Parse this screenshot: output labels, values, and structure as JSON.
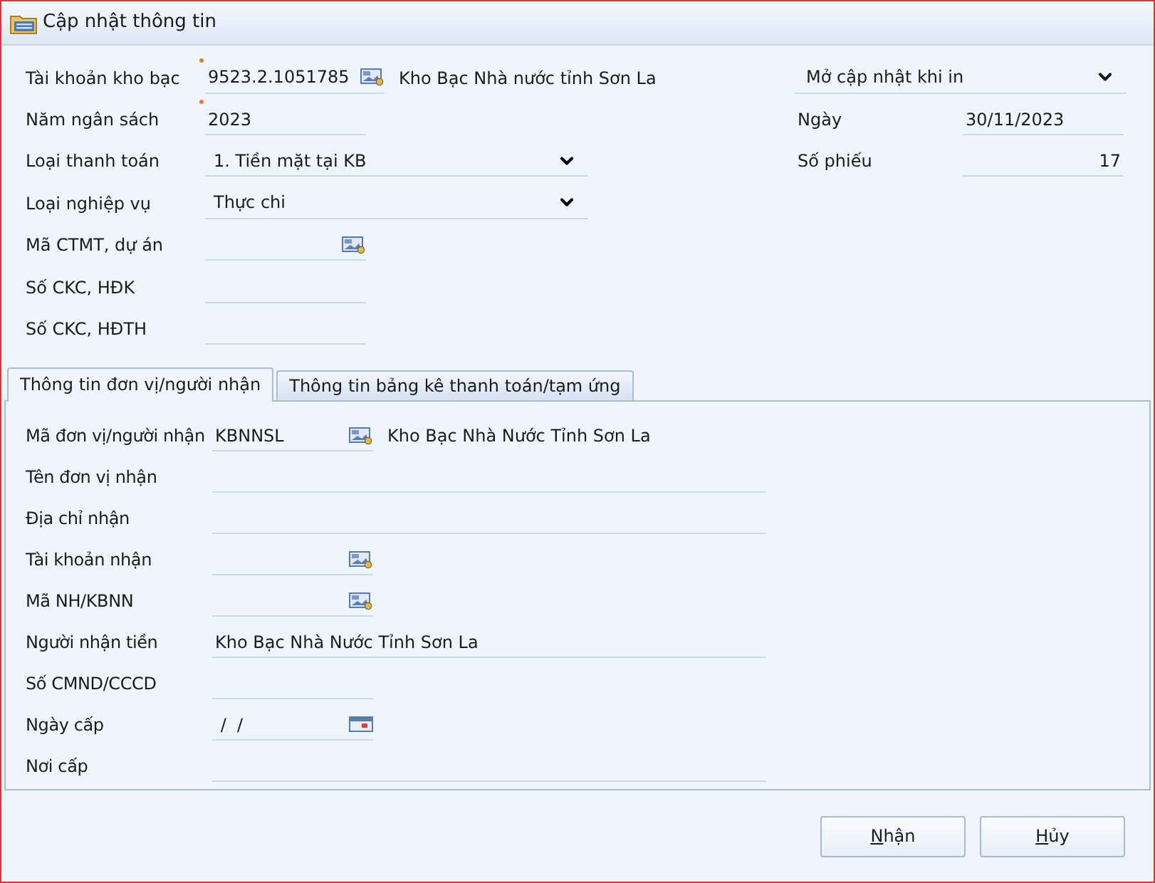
{
  "window": {
    "title": "Cập nhật thông tin"
  },
  "top_fields": [
    {
      "kind": "lookup",
      "label": "Tài khoản kho bạc",
      "required": true,
      "value": "9523.2.1051785",
      "description": "Kho Bạc Nhà nước tỉnh Sơn La"
    },
    {
      "kind": "text",
      "label": "Năm ngân sách",
      "required": true,
      "value": "2023"
    },
    {
      "kind": "select",
      "label": "Loại thanh toán",
      "value": "1. Tiền mặt tại KB"
    },
    {
      "kind": "select",
      "label": "Loại nghiệp vụ",
      "value": "Thực chi"
    },
    {
      "kind": "lookup",
      "label": "Mã CTMT, dự án"
    },
    {
      "kind": "text",
      "label": "Số CKC, HĐK"
    },
    {
      "kind": "text",
      "label": "Số CKC, HĐTH"
    }
  ],
  "print_mode": {
    "value": "Mở cập nhật khi in"
  },
  "right_fields": [
    {
      "kind": "date",
      "label": "Ngày",
      "value": "30/11/2023"
    },
    {
      "kind": "number",
      "label": "Số phiếu",
      "value": "17"
    }
  ],
  "tabs": [
    {
      "label": "Thông tin đơn vị/người nhận",
      "selected": true
    },
    {
      "label": "Thông tin bảng kê thanh toán/tạm ứng",
      "selected": false
    }
  ],
  "tab_fields": [
    {
      "kind": "lookup",
      "label": "Mã đơn vị/người nhận",
      "value": "KBNNSL",
      "description": "Kho Bạc Nhà Nước Tỉnh Sơn La"
    },
    {
      "kind": "longtext",
      "label": "Tên đơn vị nhận"
    },
    {
      "kind": "longtext",
      "label": "Địa chỉ nhận"
    },
    {
      "kind": "lookup",
      "label": "Tài khoản nhận"
    },
    {
      "kind": "lookup",
      "label": "Mã NH/KBNN"
    },
    {
      "kind": "longtext",
      "label": "Người nhận tiền",
      "value": "Kho Bạc Nhà Nước Tỉnh Sơn La"
    },
    {
      "kind": "text",
      "label": "Số CMND/CCCD"
    },
    {
      "kind": "date",
      "label": "Ngày cấp",
      "value": " /  /"
    },
    {
      "kind": "longtext",
      "label": "Nơi cấp"
    }
  ],
  "buttons": [
    "Nhận",
    "Hủy"
  ]
}
